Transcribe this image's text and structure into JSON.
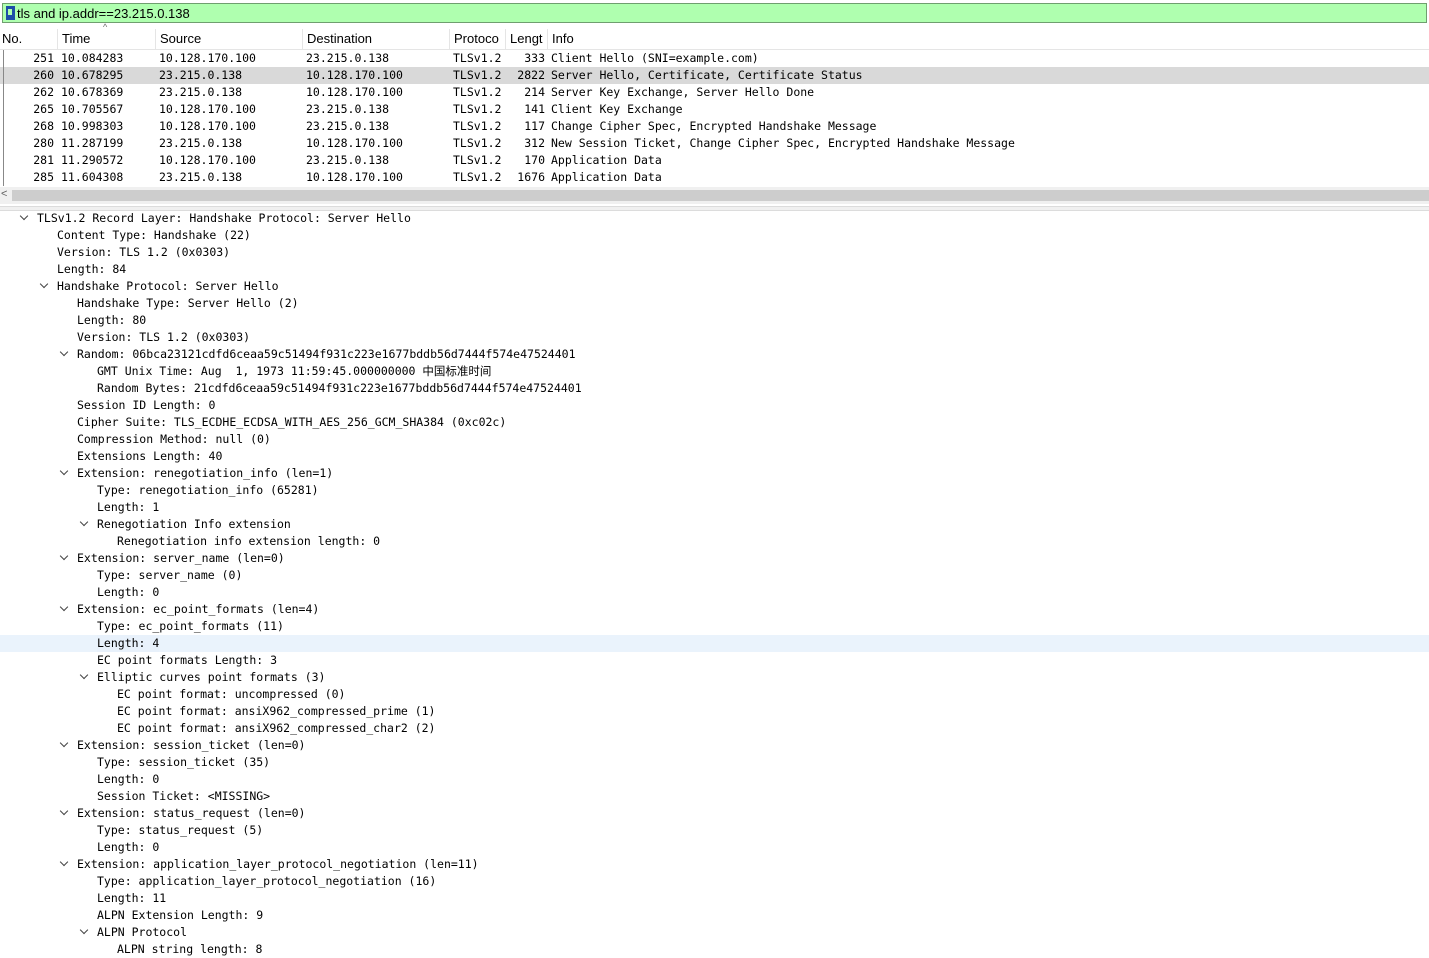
{
  "filter": {
    "text": "tls and ip.addr==23.215.0.138"
  },
  "columns": [
    "No.",
    "Time",
    "Source",
    "Destination",
    "Protoco",
    "Lengt",
    "Info"
  ],
  "packets": [
    {
      "no": "251",
      "time": "10.084283",
      "src": "10.128.170.100",
      "dst": "23.215.0.138",
      "proto": "TLSv1.2",
      "len": "333",
      "info": "Client Hello (SNI=example.com)"
    },
    {
      "no": "260",
      "time": "10.678295",
      "src": "23.215.0.138",
      "dst": "10.128.170.100",
      "proto": "TLSv1.2",
      "len": "2822",
      "info": "Server Hello, Certificate, Certificate Status"
    },
    {
      "no": "262",
      "time": "10.678369",
      "src": "23.215.0.138",
      "dst": "10.128.170.100",
      "proto": "TLSv1.2",
      "len": "214",
      "info": "Server Key Exchange, Server Hello Done"
    },
    {
      "no": "265",
      "time": "10.705567",
      "src": "10.128.170.100",
      "dst": "23.215.0.138",
      "proto": "TLSv1.2",
      "len": "141",
      "info": "Client Key Exchange"
    },
    {
      "no": "268",
      "time": "10.998303",
      "src": "10.128.170.100",
      "dst": "23.215.0.138",
      "proto": "TLSv1.2",
      "len": "117",
      "info": "Change Cipher Spec, Encrypted Handshake Message"
    },
    {
      "no": "280",
      "time": "11.287199",
      "src": "23.215.0.138",
      "dst": "10.128.170.100",
      "proto": "TLSv1.2",
      "len": "312",
      "info": "New Session Ticket, Change Cipher Spec, Encrypted Handshake Message"
    },
    {
      "no": "281",
      "time": "11.290572",
      "src": "10.128.170.100",
      "dst": "23.215.0.138",
      "proto": "TLSv1.2",
      "len": "170",
      "info": "Application Data"
    },
    {
      "no": "285",
      "time": "11.604308",
      "src": "23.215.0.138",
      "dst": "10.128.170.100",
      "proto": "TLSv1.2",
      "len": "1676",
      "info": "Application Data"
    }
  ],
  "selected_packet_no": "260",
  "tree": [
    {
      "text": "TLSv1.2 Record Layer: Handshake Protocol: Server Hello",
      "level": 0,
      "expanded": true
    },
    {
      "text": "Content Type: Handshake (22)",
      "level": 1
    },
    {
      "text": "Version: TLS 1.2 (0x0303)",
      "level": 1
    },
    {
      "text": "Length: 84",
      "level": 1
    },
    {
      "text": "Handshake Protocol: Server Hello",
      "level": 1,
      "expanded": true
    },
    {
      "text": "Handshake Type: Server Hello (2)",
      "level": 2
    },
    {
      "text": "Length: 80",
      "level": 2
    },
    {
      "text": "Version: TLS 1.2 (0x0303)",
      "level": 2
    },
    {
      "text": "Random: 06bca23121cdfd6ceaa59c51494f931c223e1677bddb56d7444f574e47524401",
      "level": 2,
      "expanded": true
    },
    {
      "text": "GMT Unix Time: Aug  1, 1973 11:59:45.000000000 中国标准时间",
      "level": 3
    },
    {
      "text": "Random Bytes: 21cdfd6ceaa59c51494f931c223e1677bddb56d7444f574e47524401",
      "level": 3
    },
    {
      "text": "Session ID Length: 0",
      "level": 2
    },
    {
      "text": "Cipher Suite: TLS_ECDHE_ECDSA_WITH_AES_256_GCM_SHA384 (0xc02c)",
      "level": 2
    },
    {
      "text": "Compression Method: null (0)",
      "level": 2
    },
    {
      "text": "Extensions Length: 40",
      "level": 2
    },
    {
      "text": "Extension: renegotiation_info (len=1)",
      "level": 2,
      "expanded": true
    },
    {
      "text": "Type: renegotiation_info (65281)",
      "level": 3
    },
    {
      "text": "Length: 1",
      "level": 3
    },
    {
      "text": "Renegotiation Info extension",
      "level": 3,
      "expanded": true
    },
    {
      "text": "Renegotiation info extension length: 0",
      "level": 4
    },
    {
      "text": "Extension: server_name (len=0)",
      "level": 2,
      "expanded": true
    },
    {
      "text": "Type: server_name (0)",
      "level": 3
    },
    {
      "text": "Length: 0",
      "level": 3
    },
    {
      "text": "Extension: ec_point_formats (len=4)",
      "level": 2,
      "expanded": true
    },
    {
      "text": "Type: ec_point_formats (11)",
      "level": 3
    },
    {
      "text": "Length: 4",
      "level": 3,
      "highlighted": true
    },
    {
      "text": "EC point formats Length: 3",
      "level": 3
    },
    {
      "text": "Elliptic curves point formats (3)",
      "level": 3,
      "expanded": true
    },
    {
      "text": "EC point format: uncompressed (0)",
      "level": 4
    },
    {
      "text": "EC point format: ansiX962_compressed_prime (1)",
      "level": 4
    },
    {
      "text": "EC point format: ansiX962_compressed_char2 (2)",
      "level": 4
    },
    {
      "text": "Extension: session_ticket (len=0)",
      "level": 2,
      "expanded": true
    },
    {
      "text": "Type: session_ticket (35)",
      "level": 3
    },
    {
      "text": "Length: 0",
      "level": 3
    },
    {
      "text": "Session Ticket: <MISSING>",
      "level": 3
    },
    {
      "text": "Extension: status_request (len=0)",
      "level": 2,
      "expanded": true
    },
    {
      "text": "Type: status_request (5)",
      "level": 3
    },
    {
      "text": "Length: 0",
      "level": 3
    },
    {
      "text": "Extension: application_layer_protocol_negotiation (len=11)",
      "level": 2,
      "expanded": true
    },
    {
      "text": "Type: application_layer_protocol_negotiation (16)",
      "level": 3
    },
    {
      "text": "Length: 11",
      "level": 3
    },
    {
      "text": "ALPN Extension Length: 9",
      "level": 3
    },
    {
      "text": "ALPN Protocol",
      "level": 3,
      "expanded": true
    },
    {
      "text": "ALPN string length: 8",
      "level": 4
    }
  ],
  "colors": {
    "filter_ok": "#afffaf",
    "selected_row": "#d9d9d9",
    "tree_highlight": "#eaf3fc"
  }
}
